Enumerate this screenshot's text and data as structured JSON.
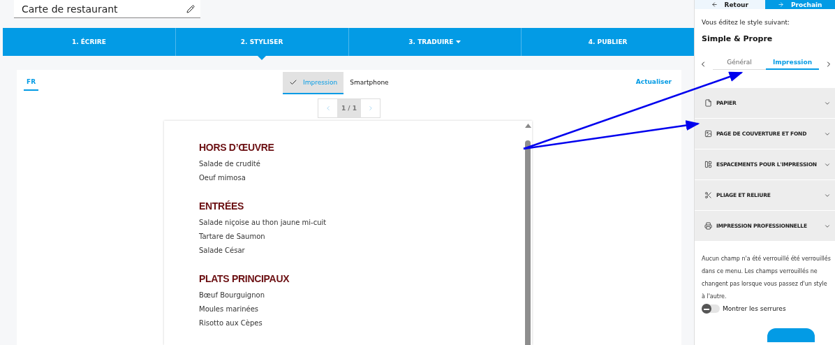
{
  "document": {
    "title": "Carte de restaurant"
  },
  "steps": [
    {
      "label": "1. ÉCRIRE",
      "selected": false,
      "dropdown": false
    },
    {
      "label": "2. STYLISER",
      "selected": true,
      "dropdown": false
    },
    {
      "label": "3. TRADUIRE",
      "selected": false,
      "dropdown": true
    },
    {
      "label": "4. PUBLIER",
      "selected": false,
      "dropdown": false
    }
  ],
  "languages": [
    {
      "label": "FR",
      "selected": true
    }
  ],
  "views": [
    {
      "label": "Impression",
      "selected": true
    },
    {
      "label": "Smartphone",
      "selected": false
    }
  ],
  "refresh": "Actualiser",
  "pager": {
    "current": "1 / 1"
  },
  "menu": [
    {
      "heading": "HORS D’ŒUVRE",
      "items": [
        "Salade de crudité",
        "Oeuf mimosa"
      ]
    },
    {
      "heading": "ENTRÉES",
      "items": [
        "Salade niçoise au thon jaune mi-cuit",
        "Tartare de Saumon",
        "Salade César"
      ]
    },
    {
      "heading": "PLATS PRINCIPAUX",
      "items": [
        "Bœuf Bourguignon",
        "Moules marinées",
        "Risotto aux Cèpes"
      ]
    }
  ],
  "nav": {
    "back": "Retour",
    "next": "Prochain"
  },
  "style": {
    "caption": "Vous éditez le style suivant:",
    "name": "Simple & Propre"
  },
  "style_tabs": [
    {
      "label": "Général",
      "selected": false
    },
    {
      "label": "Impression",
      "selected": true
    }
  ],
  "sections": [
    {
      "kind": "page",
      "label": "PAPIER",
      "expanded": false
    },
    {
      "kind": "image",
      "label": "PAGE DE COUVERTURE ET FOND",
      "expanded": false
    },
    {
      "kind": "layout",
      "label": "ESPACEMENTS POUR L'IMPRESSION",
      "expanded": false
    },
    {
      "kind": "scissors",
      "label": "PLIAGE ET RELIURE",
      "expanded": false
    },
    {
      "kind": "printer",
      "label": "IMPRESSION PROFESSIONNELLE",
      "expanded": false
    }
  ],
  "lock_note": "Aucun champ n'a été verrouillé été verrouillés dans ce menu. Les champs verrouillés ne changent pas lorsque vous passez d'un style à l'autre.",
  "locks": {
    "label": "Montrer les serrures",
    "on": false
  }
}
